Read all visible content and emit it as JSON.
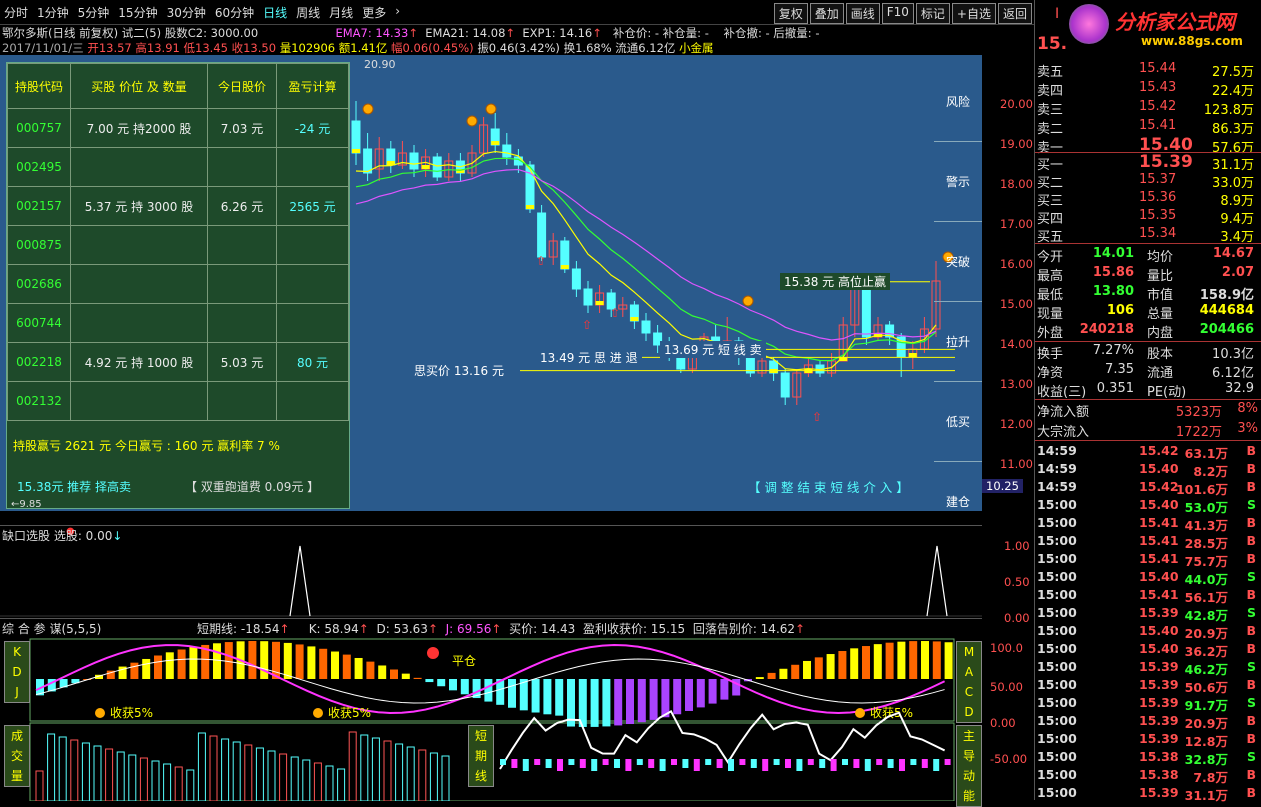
{
  "toolbar": {
    "periods": [
      "分时",
      "1分钟",
      "5分钟",
      "15分钟",
      "30分钟",
      "60分钟",
      "日线",
      "周线",
      "月线",
      "更多"
    ],
    "active_period": "日线",
    "more_arrow": "›",
    "tools": [
      "复权",
      "叠加",
      "画线",
      "F10",
      "标记",
      "+自选",
      "返回"
    ]
  },
  "header": {
    "title": "鄂尔多斯(日线 前复权) 试二(5) 股数C2: 3000.00",
    "ema7": "EMA7: 14.33",
    "ema21": "EMA21: 14.08",
    "exp1": "EXP1: 14.16",
    "bucang": "补仓价: -  补仓量: -",
    "bucang2": "补仓撤: - 后撤量: -",
    "date": "2017/11/01/三",
    "open": "开13.57",
    "high": "高13.91",
    "low": "低13.45",
    "close": "收13.50",
    "vol": "量102906",
    "amt": "额1.41亿",
    "chg": "幅0.06(0.45%)",
    "amp": "振0.46(3.42%)",
    "turn": "换1.68%",
    "flow": "流通6.12亿",
    "sector": "小金属"
  },
  "holdings": {
    "headers": [
      "持股代码",
      "买股 价位 及 数量",
      "今日股价",
      "盈亏计算"
    ],
    "rows": [
      {
        "code": "000757",
        "buy": "7.00 元   持2000 股",
        "price": "7.03 元",
        "pnl": "-24 元"
      },
      {
        "code": "002495",
        "buy": "",
        "price": "",
        "pnl": ""
      },
      {
        "code": "002157",
        "buy": "5.37 元   持 3000 股",
        "price": "6.26 元",
        "pnl": "2565 元"
      },
      {
        "code": "000875",
        "buy": "",
        "price": "",
        "pnl": ""
      },
      {
        "code": "002686",
        "buy": "",
        "price": "",
        "pnl": ""
      },
      {
        "code": "600744",
        "buy": "",
        "price": "",
        "pnl": ""
      },
      {
        "code": "002218",
        "buy": "4.92 元   持 1000 股",
        "price": "5.03 元",
        "pnl": "80 元"
      },
      {
        "code": "002132",
        "buy": "",
        "price": "",
        "pnl": ""
      }
    ],
    "summary1": "持股赢亏   2621 元    今日赢亏 :  160 元     赢利率   7 %",
    "recommend": "15.38元  推荐   择高卖",
    "fee": "【  双重跑道费  0.09元  】",
    "low_mark": "←9.85"
  },
  "chart": {
    "top_label": "20.90",
    "annotations": {
      "high_stop": "15.38 元   高位止赢",
      "short_sell": "13.69 元   短  线  卖",
      "think_retreat": "13.49 元   思 进 退",
      "think_buy": "思买价  13.16  元",
      "adjust": "【  调  整  结  束  短  线  介  入  】"
    },
    "right_buttons": [
      "风险",
      "警示",
      "突破",
      "拉升",
      "低买",
      "建仓"
    ],
    "price_ticks": [
      "20.00",
      "19.00",
      "18.00",
      "17.00",
      "16.00",
      "15.00",
      "14.00",
      "13.00",
      "12.00",
      "11.00",
      "10.25"
    ]
  },
  "sub1": {
    "title": "缺口选股  选股: 0.00",
    "ticks": [
      "1.00",
      "0.50",
      "0.00"
    ]
  },
  "sub2": {
    "title": "综 合 参 谋(5,5,5)",
    "short": "短期线: -18.54",
    "k": "K: 58.94",
    "d": "D: 53.63",
    "j": "J: 69.56",
    "buy": "买价: 14.43",
    "profit": "盈利收获价: 15.15",
    "drop": "回落告别价: 14.62",
    "labels_left": [
      "K",
      "D",
      "J"
    ],
    "labels_right": [
      "M",
      "A",
      "C",
      "D"
    ],
    "label_vol": [
      "成",
      "交",
      "量"
    ],
    "label_short": [
      "短",
      "期",
      "线"
    ],
    "label_main": [
      "主",
      "导",
      "动",
      "能"
    ],
    "harvest": "收获5%",
    "pingcang": "平仓",
    "ticks": [
      "100.0",
      "50.00",
      "0.00",
      "-50.00"
    ]
  },
  "quote": {
    "logo": "分析家公式网",
    "url": "www.88gs.com",
    "price_head": "15.",
    "asks": [
      {
        "label": "卖五",
        "price": "15.44",
        "vol": "27.5万"
      },
      {
        "label": "卖四",
        "price": "15.43",
        "vol": "22.4万"
      },
      {
        "label": "卖三",
        "price": "15.42",
        "vol": "123.8万"
      },
      {
        "label": "卖二",
        "price": "15.41",
        "vol": "86.3万"
      },
      {
        "label": "卖一",
        "price": "15.40",
        "vol": "57.6万"
      }
    ],
    "bids": [
      {
        "label": "买一",
        "price": "15.39",
        "vol": "31.1万"
      },
      {
        "label": "买二",
        "price": "15.37",
        "vol": "33.0万"
      },
      {
        "label": "买三",
        "price": "15.36",
        "vol": "8.9万"
      },
      {
        "label": "买四",
        "price": "15.35",
        "vol": "9.4万"
      },
      {
        "label": "买五",
        "price": "15.34",
        "vol": "3.4万"
      }
    ],
    "stats": [
      {
        "l1": "今开",
        "v1": "14.01",
        "c1": "#3f3",
        "l2": "均价",
        "v2": "14.67",
        "c2": "#ff5050"
      },
      {
        "l1": "最高",
        "v1": "15.86",
        "c1": "#ff5050",
        "l2": "量比",
        "v2": "2.07",
        "c2": "#ff5050"
      },
      {
        "l1": "最低",
        "v1": "13.80",
        "c1": "#3f3",
        "l2": "市值",
        "v2": "158.9亿",
        "c2": "#ddd"
      },
      {
        "l1": "现量",
        "v1": "106",
        "c1": "#ff0",
        "l2": "总量",
        "v2": "444684",
        "c2": "#ff0"
      },
      {
        "l1": "外盘",
        "v1": "240218",
        "c1": "#ff5050",
        "l2": "内盘",
        "v2": "204466",
        "c2": "#3f3"
      }
    ],
    "stats2": [
      {
        "l1": "换手",
        "v1": "7.27%",
        "l2": "股本",
        "v2": "10.3亿"
      },
      {
        "l1": "净资",
        "v1": "7.35",
        "l2": "流通",
        "v2": "6.12亿"
      },
      {
        "l1": "收益(三)",
        "v1": "0.351",
        "l2": "PE(动)",
        "v2": "32.9"
      }
    ],
    "flows": [
      {
        "l": "净流入额",
        "v": "5323万",
        "p": "8%"
      },
      {
        "l": "大宗流入",
        "v": "1722万",
        "p": "3%"
      }
    ],
    "trades": [
      {
        "t": "14:59",
        "p": "15.42",
        "v": "63.1万",
        "s": "B"
      },
      {
        "t": "14:59",
        "p": "15.40",
        "v": "8.2万",
        "s": "B"
      },
      {
        "t": "14:59",
        "p": "15.42",
        "v": "101.6万",
        "s": "B"
      },
      {
        "t": "15:00",
        "p": "15.40",
        "v": "53.0万",
        "s": "S"
      },
      {
        "t": "15:00",
        "p": "15.41",
        "v": "41.3万",
        "s": "B"
      },
      {
        "t": "15:00",
        "p": "15.41",
        "v": "28.5万",
        "s": "B"
      },
      {
        "t": "15:00",
        "p": "15.41",
        "v": "75.7万",
        "s": "B"
      },
      {
        "t": "15:00",
        "p": "15.40",
        "v": "44.0万",
        "s": "S"
      },
      {
        "t": "15:00",
        "p": "15.41",
        "v": "56.1万",
        "s": "B"
      },
      {
        "t": "15:00",
        "p": "15.39",
        "v": "42.8万",
        "s": "S"
      },
      {
        "t": "15:00",
        "p": "15.40",
        "v": "20.9万",
        "s": "B"
      },
      {
        "t": "15:00",
        "p": "15.40",
        "v": "36.2万",
        "s": "B"
      },
      {
        "t": "15:00",
        "p": "15.39",
        "v": "46.2万",
        "s": "S"
      },
      {
        "t": "15:00",
        "p": "15.39",
        "v": "50.6万",
        "s": "B"
      },
      {
        "t": "15:00",
        "p": "15.39",
        "v": "91.7万",
        "s": "S"
      },
      {
        "t": "15:00",
        "p": "15.39",
        "v": "20.9万",
        "s": "B"
      },
      {
        "t": "15:00",
        "p": "15.39",
        "v": "12.8万",
        "s": "B"
      },
      {
        "t": "15:00",
        "p": "15.38",
        "v": "32.8万",
        "s": "S"
      },
      {
        "t": "15:00",
        "p": "15.38",
        "v": "7.8万",
        "s": "B"
      },
      {
        "t": "15:00",
        "p": "15.39",
        "v": "31.1万",
        "s": "B"
      }
    ]
  },
  "colors": {
    "up": "#ff5050",
    "down": "#5ff",
    "bg_chart": "#2a5a8c",
    "panel": "#1e4a2a",
    "yellow": "#ffff00"
  }
}
